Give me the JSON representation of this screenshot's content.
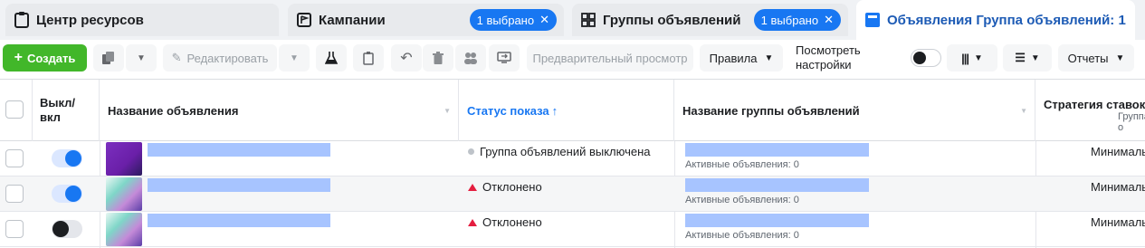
{
  "tabs": [
    {
      "label": "Центр ресурсов",
      "icon": "clipboard-icon"
    },
    {
      "label": "Кампании",
      "icon": "flag-icon",
      "selected": "1 выбрано"
    },
    {
      "label": "Группы объявлений",
      "icon": "grid-icon",
      "selected": "1 выбрано"
    },
    {
      "label": "Объявления Группа объявлений: 1",
      "icon": "ad-icon"
    }
  ],
  "toolbar": {
    "create": "Создать",
    "edit": "Редактировать",
    "preview": "Предварительный просмотр",
    "rules": "Правила",
    "view_settings": "Посмотреть настройки",
    "reports": "Отчеты"
  },
  "table": {
    "headers": {
      "onoff": "Выкл/ вкл",
      "ad_name": "Название объявления",
      "status": "Статус показа",
      "adset_name": "Название группы объявлений",
      "strategy": "Стратегия ставок",
      "strategy_sub": "Группа о"
    },
    "rows": [
      {
        "on": true,
        "status": "Группа объявлений выключена",
        "status_kind": "gray",
        "active_ads": "Активные объявления: 0",
        "strategy": "Минималь"
      },
      {
        "on": true,
        "status": "Отклонено",
        "status_kind": "red",
        "active_ads": "Активные объявления: 0",
        "strategy": "Минималь"
      },
      {
        "on": false,
        "status": "Отклонено",
        "status_kind": "red",
        "active_ads": "Активные объявления: 0",
        "strategy": "Минималь"
      }
    ]
  },
  "colors": {
    "accent": "#1877f2",
    "create_green": "#42b72a",
    "rejected": "#e41e3f"
  }
}
